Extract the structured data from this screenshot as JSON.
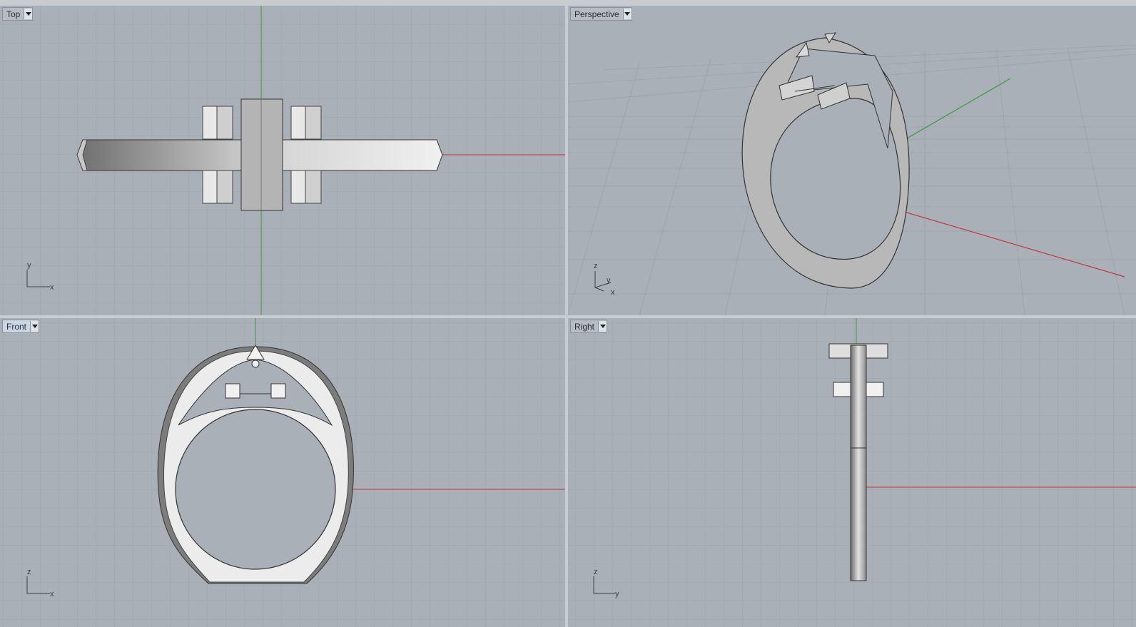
{
  "viewports": {
    "top": {
      "name": "Top",
      "axes": [
        "y",
        "x"
      ]
    },
    "perspective": {
      "name": "Perspective",
      "axes": [
        "z",
        "y",
        "x"
      ]
    },
    "front": {
      "name": "Front",
      "axes": [
        "z",
        "x"
      ]
    },
    "right": {
      "name": "Right",
      "axes": [
        "z",
        "y"
      ]
    }
  },
  "colors": {
    "background": "#a9b0b8",
    "grid": "#98a0a8",
    "grid_major": "#8a929a",
    "x_axis": "#c0393b",
    "y_axis": "#3a9a3a",
    "active_label": "#c9d6e6"
  },
  "icons": {
    "dropdown": "chevron-down-icon",
    "axis_gizmo": "axis-gizmo-icon"
  }
}
